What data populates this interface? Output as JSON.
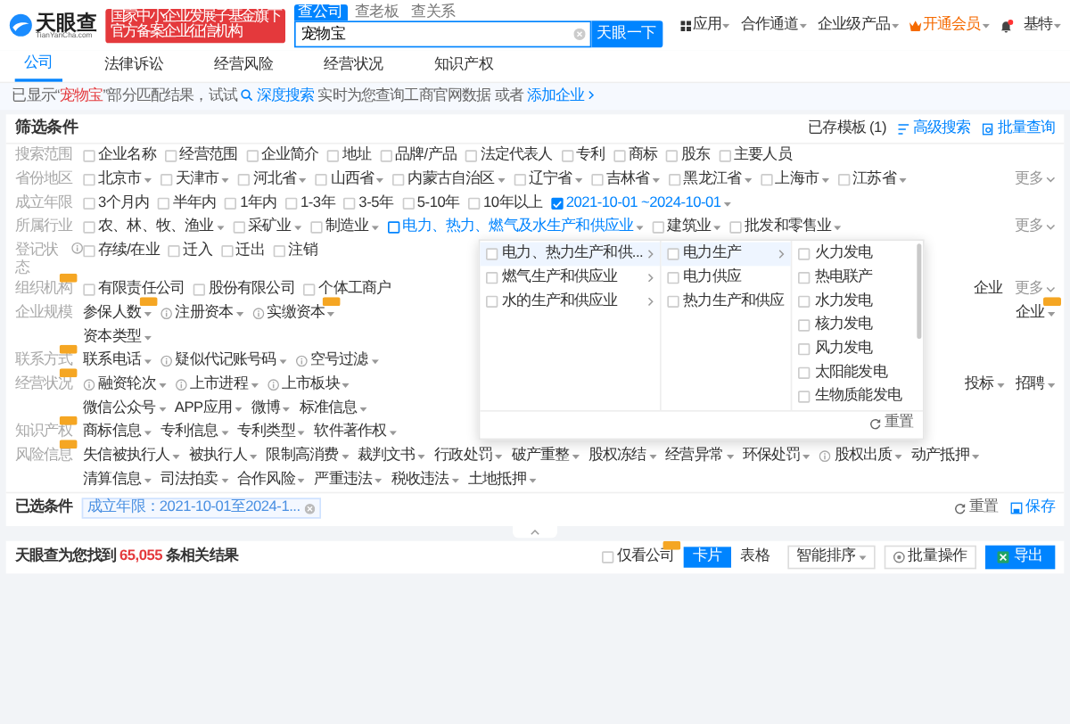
{
  "header": {
    "logo_name": "天眼查",
    "logo_domain": "TianYanCha.com",
    "badge_lines": [
      "国家中小企业发展子基金旗下",
      "官方备案企业征信机构"
    ],
    "search_tabs": [
      {
        "label": "查公司",
        "selected": true
      },
      {
        "label": "查老板",
        "selected": false
      },
      {
        "label": "查关系",
        "selected": false
      }
    ],
    "search_value": "宠物宝",
    "search_button": "天眼一下",
    "nav": [
      {
        "label": "应用",
        "kind": "apps"
      },
      {
        "label": "合作通道",
        "kind": "plain"
      },
      {
        "label": "企业级产品",
        "kind": "plain"
      },
      {
        "label": "开通会员",
        "kind": "vip"
      }
    ],
    "notifications": {
      "unread": true
    },
    "user": "基特"
  },
  "tabs": [
    {
      "label": "公司",
      "selected": true
    },
    {
      "label": "法律诉讼",
      "selected": false
    },
    {
      "label": "经营风险",
      "selected": false
    },
    {
      "label": "经营状况",
      "selected": false
    },
    {
      "label": "知识产权",
      "selected": false
    }
  ],
  "notice": {
    "before": "已显示“",
    "keyword": "宠物宝",
    "after": "”部分匹配结果，试试",
    "deep_search": "深度搜索",
    "middle": "实时为您查询工商官网数据 或者",
    "add_link": "添加企业"
  },
  "filter": {
    "title": "筛选条件",
    "templates": "已存模板 (1)",
    "advanced": "高级搜索",
    "batch": "批量查询",
    "rows": [
      {
        "label": "搜索范围",
        "vip": false,
        "info": false,
        "lines": [
          [
            {
              "label": "企业名称",
              "kind": "check",
              "checked": false,
              "vip": false
            },
            {
              "label": "经营范围",
              "kind": "check",
              "checked": false,
              "vip": false
            },
            {
              "label": "企业简介",
              "kind": "check",
              "checked": false,
              "vip": false
            },
            {
              "label": "地址",
              "kind": "check",
              "checked": false,
              "vip": false
            },
            {
              "label": "品牌/产品",
              "kind": "check",
              "checked": false,
              "vip": false
            },
            {
              "label": "法定代表人",
              "kind": "check",
              "checked": false,
              "vip": false
            },
            {
              "label": "专利",
              "kind": "check",
              "checked": false,
              "vip": false
            },
            {
              "label": "商标",
              "kind": "check",
              "checked": false,
              "vip": false
            },
            {
              "label": "股东",
              "kind": "check",
              "checked": false,
              "vip": false
            },
            {
              "label": "主要人员",
              "kind": "check",
              "checked": false,
              "vip": false
            }
          ]
        ],
        "right": []
      },
      {
        "label": "省份地区",
        "vip": false,
        "info": false,
        "lines": [
          [
            {
              "label": "北京市",
              "kind": "check-select",
              "checked": false,
              "vip": false
            },
            {
              "label": "天津市",
              "kind": "check-select",
              "checked": false,
              "vip": false
            },
            {
              "label": "河北省",
              "kind": "check-select",
              "checked": false,
              "vip": false
            },
            {
              "label": "山西省",
              "kind": "check-select",
              "checked": false,
              "vip": false
            },
            {
              "label": "内蒙古自治区",
              "kind": "check-select",
              "checked": false,
              "vip": false
            },
            {
              "label": "辽宁省",
              "kind": "check-select",
              "checked": false,
              "vip": false
            },
            {
              "label": "吉林省",
              "kind": "check-select",
              "checked": false,
              "vip": false
            },
            {
              "label": "黑龙江省",
              "kind": "check-select",
              "checked": false,
              "vip": false
            },
            {
              "label": "上海市",
              "kind": "check-select",
              "checked": false,
              "vip": false
            },
            {
              "label": "江苏省",
              "kind": "check-select",
              "checked": false,
              "vip": false
            }
          ]
        ],
        "right": [
          {
            "label": "更多",
            "kind": "more",
            "vip": false
          }
        ]
      },
      {
        "label": "成立年限",
        "vip": false,
        "info": false,
        "lines": [
          [
            {
              "label": "3个月内",
              "kind": "check",
              "checked": false,
              "vip": false
            },
            {
              "label": "半年内",
              "kind": "check",
              "checked": false,
              "vip": false
            },
            {
              "label": "1年内",
              "kind": "check",
              "checked": false,
              "vip": false
            },
            {
              "label": "1-3年",
              "kind": "check",
              "checked": false,
              "vip": false
            },
            {
              "label": "3-5年",
              "kind": "check",
              "checked": false,
              "vip": false
            },
            {
              "label": "5-10年",
              "kind": "check",
              "checked": false,
              "vip": false
            },
            {
              "label": "10年以上",
              "kind": "check",
              "checked": false,
              "vip": false
            },
            {
              "label": "2021-10-01 ~2024-10-01",
              "kind": "check-select",
              "checked": true,
              "vip": false
            }
          ]
        ],
        "right": []
      },
      {
        "label": "所属行业",
        "vip": false,
        "info": false,
        "lines": [
          [
            {
              "label": "农、林、牧、渔业",
              "kind": "check-select",
              "checked": false,
              "vip": false,
              "selected": false
            },
            {
              "label": "采矿业",
              "kind": "check-select",
              "checked": false,
              "vip": false,
              "selected": false
            },
            {
              "label": "制造业",
              "kind": "check-select",
              "checked": false,
              "vip": false,
              "selected": false
            },
            {
              "label": "电力、热力、燃气及水生产和供应业",
              "kind": "check-select",
              "checked": false,
              "vip": false,
              "selected": true
            },
            {
              "label": "建筑业",
              "kind": "check-select",
              "checked": false,
              "vip": false,
              "selected": false
            },
            {
              "label": "批发和零售业",
              "kind": "check-select",
              "checked": false,
              "vip": false,
              "selected": false
            }
          ]
        ],
        "right": [
          {
            "label": "更多",
            "kind": "more",
            "vip": false
          }
        ]
      },
      {
        "label": "登记状态",
        "vip": false,
        "info": true,
        "lines": [
          [
            {
              "label": "存续/在业",
              "kind": "check",
              "checked": false,
              "vip": false
            },
            {
              "label": "迁入",
              "kind": "check",
              "checked": false,
              "vip": false
            },
            {
              "label": "迁出",
              "kind": "check",
              "checked": false,
              "vip": false
            },
            {
              "label": "注销",
              "kind": "check",
              "checked": false,
              "vip": false
            }
          ]
        ],
        "right": []
      },
      {
        "label": "组织机构",
        "vip": true,
        "info": false,
        "lines": [
          [
            {
              "label": "有限责任公司",
              "kind": "check",
              "checked": false,
              "vip": false
            },
            {
              "label": "股份有限公司",
              "kind": "check",
              "checked": false,
              "vip": false
            },
            {
              "label": "个体工商户",
              "kind": "check",
              "checked": false,
              "vip": false
            }
          ]
        ],
        "right": [
          {
            "label": "企业",
            "kind": "plain",
            "vip": false
          },
          {
            "label": "更多",
            "kind": "more",
            "vip": false
          }
        ]
      },
      {
        "label": "企业规模",
        "vip": false,
        "info": false,
        "lines": [
          [
            {
              "label": "参保人数",
              "kind": "select",
              "vip": true
            },
            {
              "label": "注册资本",
              "kind": "info-select",
              "vip": false
            },
            {
              "label": "实缴资本",
              "kind": "info-select",
              "vip": true
            }
          ],
          [
            {
              "label": "资本类型",
              "kind": "select",
              "vip": false
            }
          ]
        ],
        "right": [
          {
            "label": "企业",
            "kind": "select",
            "vip": true
          }
        ]
      },
      {
        "label": "联系方式",
        "vip": true,
        "info": false,
        "lines": [
          [
            {
              "label": "联系电话",
              "kind": "select",
              "vip": false
            },
            {
              "label": "疑似代记账号码",
              "kind": "info-select",
              "vip": false
            },
            {
              "label": "空号过滤",
              "kind": "info-select",
              "vip": false
            }
          ]
        ],
        "right": []
      },
      {
        "label": "经营状况",
        "vip": true,
        "info": false,
        "lines": [
          [
            {
              "label": "融资轮次",
              "kind": "info-select",
              "vip": false
            },
            {
              "label": "上市进程",
              "kind": "info-select",
              "vip": false
            },
            {
              "label": "上市板块",
              "kind": "info-select",
              "vip": false
            }
          ],
          [
            {
              "label": "微信公众号",
              "kind": "select",
              "vip": false
            },
            {
              "label": "APP应用",
              "kind": "select",
              "vip": false
            },
            {
              "label": "微博",
              "kind": "select",
              "vip": false
            },
            {
              "label": "标准信息",
              "kind": "select",
              "vip": false
            }
          ]
        ],
        "right": [
          {
            "label": "投标",
            "kind": "select",
            "vip": false
          },
          {
            "label": "招聘",
            "kind": "select",
            "vip": false
          }
        ]
      },
      {
        "label": "知识产权",
        "vip": true,
        "info": false,
        "lines": [
          [
            {
              "label": "商标信息",
              "kind": "select",
              "vip": false
            },
            {
              "label": "专利信息",
              "kind": "select",
              "vip": false
            },
            {
              "label": "专利类型",
              "kind": "select",
              "vip": false
            },
            {
              "label": "软件著作权",
              "kind": "select",
              "vip": false
            }
          ]
        ],
        "right": []
      },
      {
        "label": "风险信息",
        "vip": true,
        "info": false,
        "lines": [
          [
            {
              "label": "失信被执行人",
              "kind": "select",
              "vip": false
            },
            {
              "label": "被执行人",
              "kind": "select",
              "vip": false
            },
            {
              "label": "限制高消费",
              "kind": "select",
              "vip": false
            },
            {
              "label": "裁判文书",
              "kind": "select",
              "vip": false
            },
            {
              "label": "行政处罚",
              "kind": "select",
              "vip": false
            },
            {
              "label": "破产重整",
              "kind": "select",
              "vip": false
            },
            {
              "label": "股权冻结",
              "kind": "select",
              "vip": false
            },
            {
              "label": "经营异常",
              "kind": "select",
              "vip": false
            },
            {
              "label": "环保处罚",
              "kind": "select",
              "vip": false
            },
            {
              "label": "股权出质",
              "kind": "info-select",
              "vip": false
            },
            {
              "label": "动产抵押",
              "kind": "select",
              "vip": false
            }
          ],
          [
            {
              "label": "清算信息",
              "kind": "select",
              "vip": false
            },
            {
              "label": "司法拍卖",
              "kind": "select",
              "vip": false
            },
            {
              "label": "合作风险",
              "kind": "select",
              "vip": false
            },
            {
              "label": "严重违法",
              "kind": "select",
              "vip": false
            },
            {
              "label": "税收违法",
              "kind": "select",
              "vip": false
            },
            {
              "label": "土地抵押",
              "kind": "select",
              "vip": false
            }
          ]
        ],
        "right": []
      }
    ],
    "dropdown": {
      "columns": [
        [
          {
            "label": "电力、热力生产和供...",
            "checked": false,
            "has_children": true,
            "selected": true
          },
          {
            "label": "燃气生产和供应业",
            "checked": false,
            "has_children": true,
            "selected": false
          },
          {
            "label": "水的生产和供应业",
            "checked": false,
            "has_children": true,
            "selected": false
          }
        ],
        [
          {
            "label": "电力生产",
            "checked": false,
            "has_children": true,
            "selected": true
          },
          {
            "label": "电力供应",
            "checked": false,
            "has_children": false,
            "selected": false
          },
          {
            "label": "热力生产和供应",
            "checked": false,
            "has_children": false,
            "selected": false
          }
        ],
        [
          {
            "label": "火力发电",
            "checked": false,
            "has_children": false,
            "selected": false
          },
          {
            "label": "热电联产",
            "checked": false,
            "has_children": false,
            "selected": false
          },
          {
            "label": "水力发电",
            "checked": false,
            "has_children": false,
            "selected": false
          },
          {
            "label": "核力发电",
            "checked": false,
            "has_children": false,
            "selected": false
          },
          {
            "label": "风力发电",
            "checked": false,
            "has_children": false,
            "selected": false
          },
          {
            "label": "太阳能发电",
            "checked": false,
            "has_children": false,
            "selected": false
          },
          {
            "label": "生物质能发电",
            "checked": false,
            "has_children": false,
            "selected": false
          }
        ]
      ],
      "reset": "重置"
    }
  },
  "selected_conditions": {
    "label": "已选条件",
    "chips": [
      "成立年限：2021-10-01至2024-1..."
    ],
    "reset": "重置",
    "save": "保存"
  },
  "results": {
    "before": "天眼查为您找到",
    "count": "65,055",
    "after": "条相关结果",
    "company_only": {
      "label": "仅看公司",
      "checked": false,
      "vip": true
    },
    "views": [
      {
        "label": "卡片",
        "selected": true
      },
      {
        "label": "表格",
        "selected": false
      }
    ],
    "sort": "智能排序",
    "batch": "批量操作",
    "export": "导出"
  }
}
